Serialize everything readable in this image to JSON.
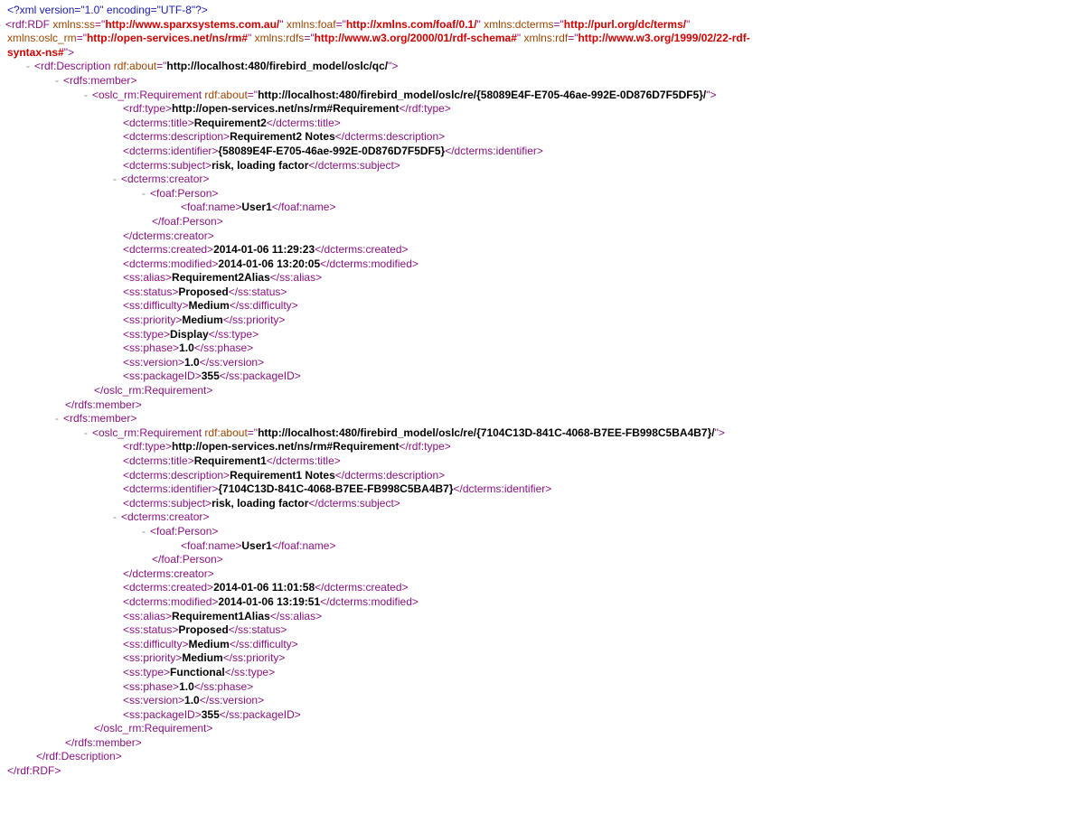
{
  "xmlDecl": "<?xml version=\"1.0\" encoding=\"UTF-8\"?>",
  "root": {
    "tag": "rdf:RDF",
    "ns": {
      "ss": "http://www.sparxsystems.com.au/",
      "foaf": "http://xmlns.com/foaf/0.1/",
      "dcterms": "http://purl.org/dc/terms/",
      "oslc_rm": "http://open-services.net/ns/rm#",
      "rdfs": "http://www.w3.org/2000/01/rdf-schema#",
      "rdf": "http://www.w3.org/1999/02/22-rdf-syntax-ns#"
    }
  },
  "description": {
    "tag": "rdf:Description",
    "about": "http://localhost:480/firebird_model/oslc/qc/"
  },
  "members": [
    {
      "reqTag": "oslc_rm:Requirement",
      "about": "http://localhost:480/firebird_model/oslc/re/{58089E4F-E705-46ae-992E-0D876D7F5DF5}/",
      "rdfType": "http://open-services.net/ns/rm#Requirement",
      "title": "Requirement2",
      "descriptionText": "Requirement2 Notes",
      "identifier": "{58089E4F-E705-46ae-992E-0D876D7F5DF5}",
      "subject": "risk, loading factor",
      "creator": "User1",
      "created": "2014-01-06 11:29:23",
      "modified": "2014-01-06 13:20:05",
      "alias": "Requirement2Alias",
      "status": "Proposed",
      "difficulty": "Medium",
      "priority": "Medium",
      "type": "Display",
      "phase": "1.0",
      "version": "1.0",
      "packageID": "355"
    },
    {
      "reqTag": "oslc_rm:Requirement",
      "about": "http://localhost:480/firebird_model/oslc/re/{7104C13D-841C-4068-B7EE-FB998C5BA4B7}/",
      "rdfType": "http://open-services.net/ns/rm#Requirement",
      "title": "Requirement1",
      "descriptionText": "Requirement1 Notes",
      "identifier": "{7104C13D-841C-4068-B7EE-FB998C5BA4B7}",
      "subject": "risk, loading factor",
      "creator": "User1",
      "created": "2014-01-06 11:01:58",
      "modified": "2014-01-06 13:19:51",
      "alias": "Requirement1Alias",
      "status": "Proposed",
      "difficulty": "Medium",
      "priority": "Medium",
      "type": "Functional",
      "phase": "1.0",
      "version": "1.0",
      "packageID": "355"
    }
  ],
  "labels": {
    "xmlns_ss": "xmlns:ss",
    "xmlns_foaf": "xmlns:foaf",
    "xmlns_dcterms": "xmlns:dcterms",
    "xmlns_oslc_rm": "xmlns:oslc_rm",
    "xmlns_rdfs": "xmlns:rdfs",
    "xmlns_rdf": "xmlns:rdf",
    "rdf_about": "rdf:about",
    "rdfs_member": "rdfs:member",
    "rdf_type": "rdf:type",
    "dcterms_title": "dcterms:title",
    "dcterms_description": "dcterms:description",
    "dcterms_identifier": "dcterms:identifier",
    "dcterms_subject": "dcterms:subject",
    "dcterms_creator": "dcterms:creator",
    "foaf_Person": "foaf:Person",
    "foaf_name": "foaf:name",
    "dcterms_created": "dcterms:created",
    "dcterms_modified": "dcterms:modified",
    "ss_alias": "ss:alias",
    "ss_status": "ss:status",
    "ss_difficulty": "ss:difficulty",
    "ss_priority": "ss:priority",
    "ss_type": "ss:type",
    "ss_phase": "ss:phase",
    "ss_version": "ss:version",
    "ss_packageID": "ss:packageID"
  }
}
